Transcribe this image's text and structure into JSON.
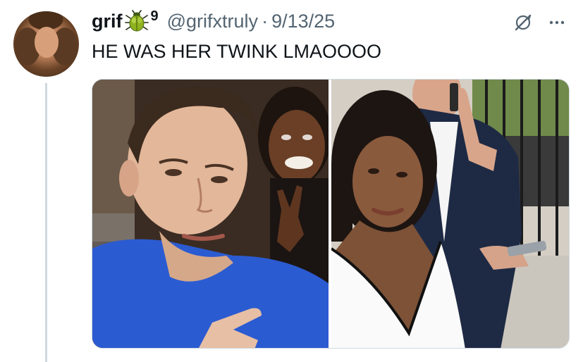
{
  "tweet": {
    "author_name": "grif",
    "badge_emoji_icon": "beetle-emoji-icon",
    "badge_number": "9",
    "handle": "@grifxtruly",
    "separator": "·",
    "date": "9/13/25",
    "text": "HE WAS HER TWINK LMAOOOO"
  },
  "actions": {
    "grok_icon": "grok-slash-icon",
    "more_icon": "more-horizontal-icon",
    "more_label": "···"
  },
  "media": {
    "count": 2,
    "photos": [
      {
        "position": "left",
        "subject": "selfie of man in blue shirt with woman making peace sign"
      },
      {
        "position": "right",
        "subject": "woman in white dress, man in suit on phone behind"
      }
    ]
  },
  "colors": {
    "text_primary": "#0f1419",
    "text_secondary": "#536471",
    "thread_line": "#cfd9de",
    "background": "#ffffff"
  }
}
